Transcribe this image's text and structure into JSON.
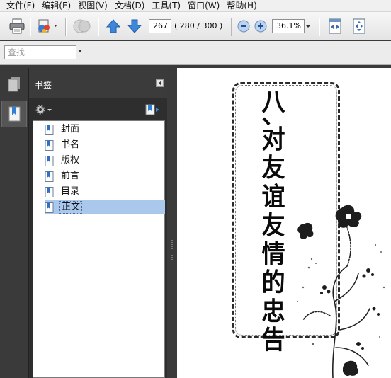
{
  "menubar": {
    "items": [
      "文件(F)",
      "编辑(E)",
      "视图(V)",
      "文档(D)",
      "工具(T)",
      "窗口(W)",
      "帮助(H)"
    ]
  },
  "toolbar": {
    "current_page": "267",
    "page_count": "( 280 / 300 )",
    "zoom": "36.1%"
  },
  "find": {
    "placeholder": "查找"
  },
  "bookmarks_panel": {
    "title": "书签",
    "items": [
      {
        "label": "封面",
        "selected": false
      },
      {
        "label": "书名",
        "selected": false
      },
      {
        "label": "版权",
        "selected": false
      },
      {
        "label": "前言",
        "selected": false
      },
      {
        "label": "目录",
        "selected": false
      },
      {
        "label": "正文",
        "selected": true
      }
    ]
  },
  "document": {
    "title_chars": [
      "八",
      "、",
      "对",
      "友",
      "谊",
      "友",
      "情",
      "的",
      "忠",
      "告"
    ]
  },
  "colors": {
    "panel_bg": "#2e2e2e",
    "selection": "#a9c8ec",
    "accent_blue": "#2f7fd6"
  }
}
